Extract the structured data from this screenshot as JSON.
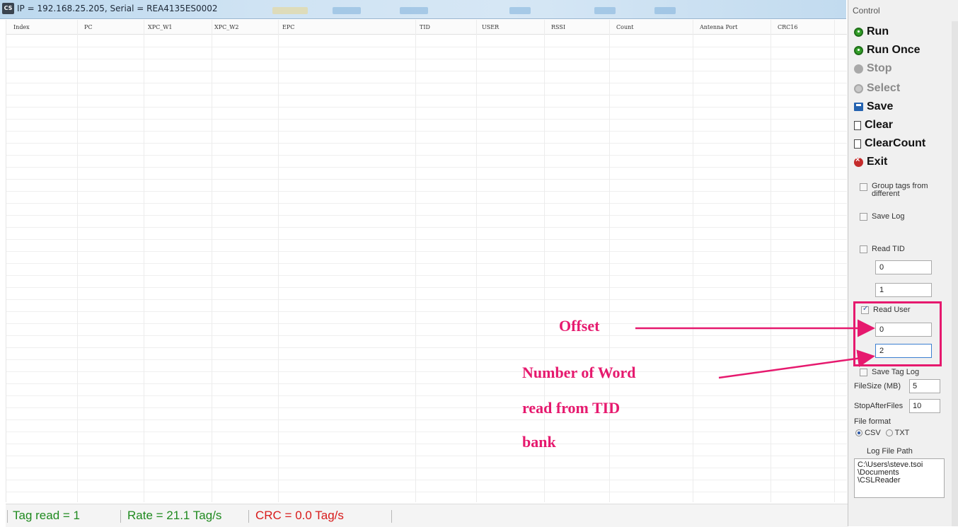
{
  "window": {
    "title": "IP = 192.168.25.205, Serial = REA4135ES0002",
    "icon_text": "CS"
  },
  "table": {
    "columns": [
      "Index",
      "PC",
      "XPC_W1",
      "XPC_W2",
      "EPC",
      "TID",
      "USER",
      "RSSI",
      "Count",
      "Antenna Port",
      "CRC16"
    ]
  },
  "status": {
    "tag_read": "Tag read = 1",
    "rate": "Rate = 21.1 Tag/s",
    "crc": "CRC = 0.0 Tag/s",
    "colors": {
      "ok": "#1f8a1f",
      "error": "#d81b1b"
    }
  },
  "control": {
    "title": "Control",
    "buttons": {
      "run": "Run",
      "run_once": "Run Once",
      "stop": "Stop",
      "select": "Select",
      "save": "Save",
      "clear": "Clear",
      "clear_count": "ClearCount",
      "exit": "Exit"
    },
    "group_tags": {
      "line1": "Group tags from",
      "line2": "different"
    },
    "save_log": "Save Log",
    "read_tid": {
      "label": "Read TID",
      "offset": "0",
      "count": "1"
    },
    "read_user": {
      "label": "Read User",
      "offset": "0",
      "count": "2"
    },
    "save_tag_log": "Save Tag Log",
    "file_size": {
      "label": "FileSize (MB)",
      "value": "5"
    },
    "stop_after": {
      "label": "StopAfterFiles",
      "value": "10"
    },
    "file_format": {
      "label": "File format",
      "csv": "CSV",
      "txt": "TXT"
    },
    "log_path": {
      "label": "Log File Path",
      "line1": "C:\\Users\\steve.tsoi",
      "line2": "\\Documents",
      "line3": "\\CSLReader"
    }
  },
  "annotations": {
    "offset": "Offset",
    "words_line1": "Number of Word",
    "words_line2": "read from TID",
    "words_line3": "bank",
    "color": "#e6196e"
  }
}
